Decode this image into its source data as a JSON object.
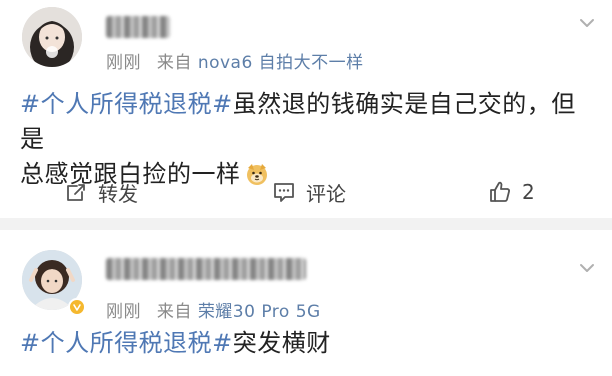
{
  "posts": [
    {
      "time": "刚刚",
      "source_prefix": "来自",
      "device": "nova6 自拍大不一样",
      "hashtag": "#个人所得税退税#",
      "text_line1": "虽然退的钱确实是自己交的，但是",
      "text_line2": "总感觉跟白捡的一样",
      "emoji": "doge-emoji",
      "actions": {
        "repost_label": "转发",
        "comment_label": "评论",
        "like_count": "2"
      }
    },
    {
      "time": "刚刚",
      "source_prefix": "来自",
      "device": "荣耀30 Pro 5G",
      "hashtag": "#个人所得税退税#",
      "text": "突发横财"
    }
  ],
  "icons": {
    "repost": "repost-icon",
    "comment": "comment-icon",
    "like": "thumbs-up-icon",
    "menu": "chevron-down-icon"
  },
  "colors": {
    "hashtag": "#4f78b4",
    "device": "#5d7ea8",
    "meta": "#8a8a8a",
    "separator": "#f2f2f2"
  }
}
